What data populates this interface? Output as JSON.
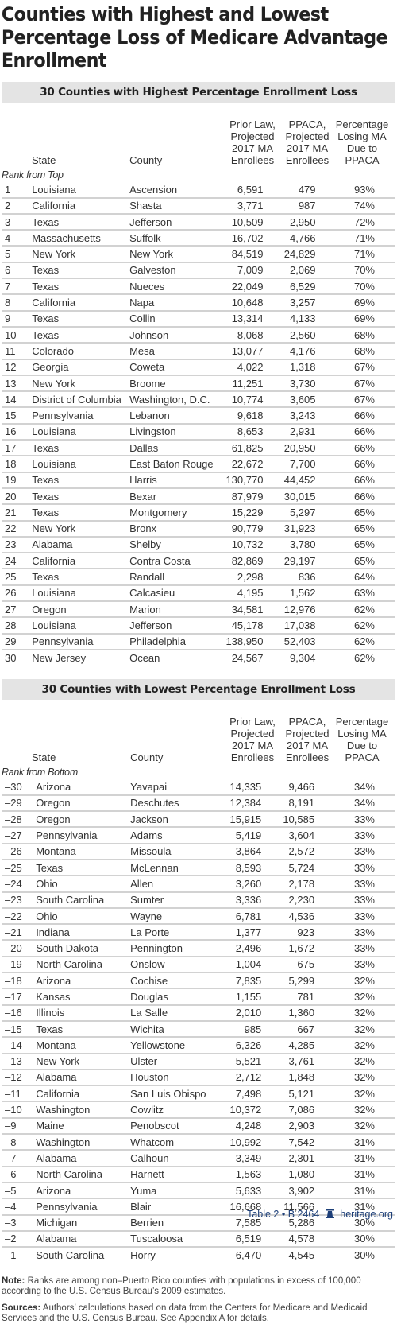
{
  "title": "Counties with Highest and Lowest Percentage Loss of Medicare Advantage Enrollment",
  "columns": {
    "state": "State",
    "county": "County",
    "prior_law": "Prior Law, Projected 2017 MA Enrollees",
    "ppaca": "PPACA, Projected 2017 MA Enrollees",
    "pct": "Percentage Losing MA Due to PPACA"
  },
  "colors": {
    "band": "#e4e4e4",
    "divider": "#d2d2d2",
    "footer": "#1d3f78"
  },
  "highest": {
    "heading": "30 Counties with Highest Percentage Enrollment Loss",
    "rank_label": "Rank from Top",
    "rows": [
      {
        "rank": "1",
        "state": "Louisiana",
        "county": "Ascension",
        "prior": "6,591",
        "ppaca": "479",
        "pct": "93%"
      },
      {
        "rank": "2",
        "state": "California",
        "county": "Shasta",
        "prior": "3,771",
        "ppaca": "987",
        "pct": "74%"
      },
      {
        "rank": "3",
        "state": "Texas",
        "county": "Jefferson",
        "prior": "10,509",
        "ppaca": "2,950",
        "pct": "72%"
      },
      {
        "rank": "4",
        "state": "Massachusetts",
        "county": "Suffolk",
        "prior": "16,702",
        "ppaca": "4,766",
        "pct": "71%"
      },
      {
        "rank": "5",
        "state": "New York",
        "county": "New York",
        "prior": "84,519",
        "ppaca": "24,829",
        "pct": "71%"
      },
      {
        "rank": "6",
        "state": "Texas",
        "county": "Galveston",
        "prior": "7,009",
        "ppaca": "2,069",
        "pct": "70%"
      },
      {
        "rank": "7",
        "state": "Texas",
        "county": "Nueces",
        "prior": "22,049",
        "ppaca": "6,529",
        "pct": "70%"
      },
      {
        "rank": "8",
        "state": "California",
        "county": "Napa",
        "prior": "10,648",
        "ppaca": "3,257",
        "pct": "69%"
      },
      {
        "rank": "9",
        "state": "Texas",
        "county": "Collin",
        "prior": "13,314",
        "ppaca": "4,133",
        "pct": "69%"
      },
      {
        "rank": "10",
        "state": "Texas",
        "county": "Johnson",
        "prior": "8,068",
        "ppaca": "2,560",
        "pct": "68%"
      },
      {
        "rank": "11",
        "state": "Colorado",
        "county": "Mesa",
        "prior": "13,077",
        "ppaca": "4,176",
        "pct": "68%"
      },
      {
        "rank": "12",
        "state": "Georgia",
        "county": "Coweta",
        "prior": "4,022",
        "ppaca": "1,318",
        "pct": "67%"
      },
      {
        "rank": "13",
        "state": "New York",
        "county": "Broome",
        "prior": "11,251",
        "ppaca": "3,730",
        "pct": "67%"
      },
      {
        "rank": "14",
        "state": "District of Columbia",
        "county": "Washington, D.C.",
        "prior": "10,774",
        "ppaca": "3,605",
        "pct": "67%"
      },
      {
        "rank": "15",
        "state": "Pennsylvania",
        "county": "Lebanon",
        "prior": "9,618",
        "ppaca": "3,243",
        "pct": "66%"
      },
      {
        "rank": "16",
        "state": "Louisiana",
        "county": "Livingston",
        "prior": "8,653",
        "ppaca": "2,931",
        "pct": "66%"
      },
      {
        "rank": "17",
        "state": "Texas",
        "county": "Dallas",
        "prior": "61,825",
        "ppaca": "20,950",
        "pct": "66%"
      },
      {
        "rank": "18",
        "state": "Louisiana",
        "county": "East Baton Rouge",
        "prior": "22,672",
        "ppaca": "7,700",
        "pct": "66%"
      },
      {
        "rank": "19",
        "state": "Texas",
        "county": "Harris",
        "prior": "130,770",
        "ppaca": "44,452",
        "pct": "66%"
      },
      {
        "rank": "20",
        "state": "Texas",
        "county": "Bexar",
        "prior": "87,979",
        "ppaca": "30,015",
        "pct": "66%"
      },
      {
        "rank": "21",
        "state": "Texas",
        "county": "Montgomery",
        "prior": "15,229",
        "ppaca": "5,297",
        "pct": "65%"
      },
      {
        "rank": "22",
        "state": "New York",
        "county": "Bronx",
        "prior": "90,779",
        "ppaca": "31,923",
        "pct": "65%"
      },
      {
        "rank": "23",
        "state": "Alabama",
        "county": "Shelby",
        "prior": "10,732",
        "ppaca": "3,780",
        "pct": "65%"
      },
      {
        "rank": "24",
        "state": "California",
        "county": "Contra Costa",
        "prior": "82,869",
        "ppaca": "29,197",
        "pct": "65%"
      },
      {
        "rank": "25",
        "state": "Texas",
        "county": "Randall",
        "prior": "2,298",
        "ppaca": "836",
        "pct": "64%"
      },
      {
        "rank": "26",
        "state": "Louisiana",
        "county": "Calcasieu",
        "prior": "4,195",
        "ppaca": "1,562",
        "pct": "63%"
      },
      {
        "rank": "27",
        "state": "Oregon",
        "county": "Marion",
        "prior": "34,581",
        "ppaca": "12,976",
        "pct": "62%"
      },
      {
        "rank": "28",
        "state": "Louisiana",
        "county": "Jefferson",
        "prior": "45,178",
        "ppaca": "17,038",
        "pct": "62%"
      },
      {
        "rank": "29",
        "state": "Pennsylvania",
        "county": "Philadelphia",
        "prior": "138,950",
        "ppaca": "52,403",
        "pct": "62%"
      },
      {
        "rank": "30",
        "state": "New Jersey",
        "county": "Ocean",
        "prior": "24,567",
        "ppaca": "9,304",
        "pct": "62%"
      }
    ]
  },
  "lowest": {
    "heading": "30 Counties with Lowest Percentage Enrollment Loss",
    "rank_label": "Rank from Bottom",
    "rows": [
      {
        "rank": "–30",
        "state": "Arizona",
        "county": "Yavapai",
        "prior": "14,335",
        "ppaca": "9,466",
        "pct": "34%"
      },
      {
        "rank": "–29",
        "state": "Oregon",
        "county": "Deschutes",
        "prior": "12,384",
        "ppaca": "8,191",
        "pct": "34%"
      },
      {
        "rank": "–28",
        "state": "Oregon",
        "county": "Jackson",
        "prior": "15,915",
        "ppaca": "10,585",
        "pct": "33%"
      },
      {
        "rank": "–27",
        "state": "Pennsylvania",
        "county": "Adams",
        "prior": "5,419",
        "ppaca": "3,604",
        "pct": "33%"
      },
      {
        "rank": "–26",
        "state": "Montana",
        "county": "Missoula",
        "prior": "3,864",
        "ppaca": "2,572",
        "pct": "33%"
      },
      {
        "rank": "–25",
        "state": "Texas",
        "county": "McLennan",
        "prior": "8,593",
        "ppaca": "5,724",
        "pct": "33%"
      },
      {
        "rank": "–24",
        "state": "Ohio",
        "county": "Allen",
        "prior": "3,260",
        "ppaca": "2,178",
        "pct": "33%"
      },
      {
        "rank": "–23",
        "state": "South Carolina",
        "county": "Sumter",
        "prior": "3,336",
        "ppaca": "2,230",
        "pct": "33%"
      },
      {
        "rank": "–22",
        "state": "Ohio",
        "county": "Wayne",
        "prior": "6,781",
        "ppaca": "4,536",
        "pct": "33%"
      },
      {
        "rank": "–21",
        "state": "Indiana",
        "county": "La Porte",
        "prior": "1,377",
        "ppaca": "923",
        "pct": "33%"
      },
      {
        "rank": "–20",
        "state": "South Dakota",
        "county": "Pennington",
        "prior": "2,496",
        "ppaca": "1,672",
        "pct": "33%"
      },
      {
        "rank": "–19",
        "state": "North Carolina",
        "county": "Onslow",
        "prior": "1,004",
        "ppaca": "675",
        "pct": "33%"
      },
      {
        "rank": "–18",
        "state": "Arizona",
        "county": "Cochise",
        "prior": "7,835",
        "ppaca": "5,299",
        "pct": "32%"
      },
      {
        "rank": "–17",
        "state": "Kansas",
        "county": "Douglas",
        "prior": "1,155",
        "ppaca": "781",
        "pct": "32%"
      },
      {
        "rank": "–16",
        "state": "Illinois",
        "county": "La Salle",
        "prior": "2,010",
        "ppaca": "1,360",
        "pct": "32%"
      },
      {
        "rank": "–15",
        "state": "Texas",
        "county": "Wichita",
        "prior": "985",
        "ppaca": "667",
        "pct": "32%"
      },
      {
        "rank": "–14",
        "state": "Montana",
        "county": "Yellowstone",
        "prior": "6,326",
        "ppaca": "4,285",
        "pct": "32%"
      },
      {
        "rank": "–13",
        "state": "New York",
        "county": "Ulster",
        "prior": "5,521",
        "ppaca": "3,761",
        "pct": "32%"
      },
      {
        "rank": "–12",
        "state": "Alabama",
        "county": "Houston",
        "prior": "2,712",
        "ppaca": "1,848",
        "pct": "32%"
      },
      {
        "rank": "–11",
        "state": "California",
        "county": "San Luis Obispo",
        "prior": "7,498",
        "ppaca": "5,121",
        "pct": "32%"
      },
      {
        "rank": "–10",
        "state": "Washington",
        "county": "Cowlitz",
        "prior": "10,372",
        "ppaca": "7,086",
        "pct": "32%"
      },
      {
        "rank": "–9",
        "state": "Maine",
        "county": "Penobscot",
        "prior": "4,248",
        "ppaca": "2,903",
        "pct": "32%"
      },
      {
        "rank": "–8",
        "state": "Washington",
        "county": "Whatcom",
        "prior": "10,992",
        "ppaca": "7,542",
        "pct": "31%"
      },
      {
        "rank": "–7",
        "state": "Alabama",
        "county": "Calhoun",
        "prior": "3,349",
        "ppaca": "2,301",
        "pct": "31%"
      },
      {
        "rank": "–6",
        "state": "North Carolina",
        "county": "Harnett",
        "prior": "1,563",
        "ppaca": "1,080",
        "pct": "31%"
      },
      {
        "rank": "–5",
        "state": "Arizona",
        "county": "Yuma",
        "prior": "5,633",
        "ppaca": "3,902",
        "pct": "31%"
      },
      {
        "rank": "–4",
        "state": "Pennsylvania",
        "county": "Blair",
        "prior": "16,668",
        "ppaca": "11,566",
        "pct": "31%"
      },
      {
        "rank": "–3",
        "state": "Michigan",
        "county": "Berrien",
        "prior": "7,585",
        "ppaca": "5,286",
        "pct": "30%"
      },
      {
        "rank": "–2",
        "state": "Alabama",
        "county": "Tuscaloosa",
        "prior": "6,519",
        "ppaca": "4,578",
        "pct": "30%"
      },
      {
        "rank": "–1",
        "state": "South Carolina",
        "county": "Horry",
        "prior": "6,470",
        "ppaca": "4,545",
        "pct": "30%"
      }
    ]
  },
  "notes": {
    "note_label": "Note:",
    "note_text": " Ranks are among non–Puerto Rico counties with populations in excess of 100,000 according to the U.S. Census Bureau’s 2009 estimates.",
    "sources_label": "Sources:",
    "sources_text": " Authors’ calculations based on data from the Centers for Medicare and Medicaid Services and the U.S. Census Bureau. See Appendix A for details."
  },
  "footer": {
    "table_ref": "Table 2 • B 2464",
    "icon": "liberty-bell-icon",
    "site": "heritage.org"
  }
}
